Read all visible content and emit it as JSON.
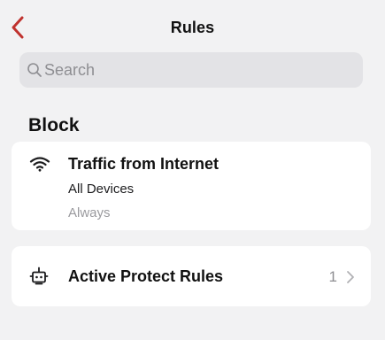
{
  "nav": {
    "title": "Rules",
    "back_icon": "chevron-left-icon",
    "accent_color": "#c0322e"
  },
  "search": {
    "placeholder": "Search",
    "icon": "search-icon"
  },
  "section": {
    "header": "Block"
  },
  "rule": {
    "icon": "wifi-icon",
    "title": "Traffic from Internet",
    "devices": "All Devices",
    "schedule": "Always"
  },
  "protect": {
    "icon": "robot-icon",
    "label": "Active Protect Rules",
    "count": "1",
    "chevron_icon": "chevron-right-icon"
  },
  "colors": {
    "background": "#f2f2f3",
    "card": "#ffffff",
    "search_bg": "#e3e3e6",
    "secondary_text": "#8e8e92"
  }
}
